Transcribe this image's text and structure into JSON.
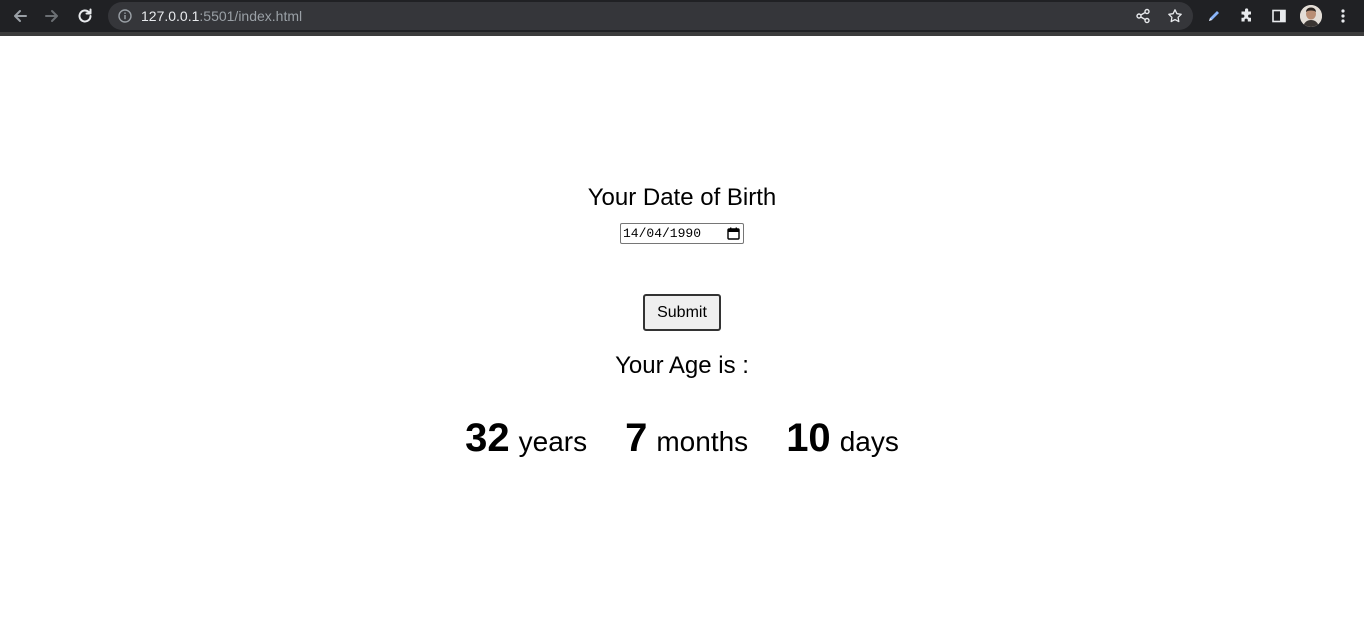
{
  "browser": {
    "url_host": "127.0.0.1",
    "url_path": ":5501/index.html"
  },
  "form": {
    "dob_label": "Your Date of Birth",
    "dob_value": "14/04/1990",
    "submit_label": "Submit"
  },
  "result": {
    "label": "Your Age is :",
    "years": "32",
    "years_unit": "years",
    "months": "7",
    "months_unit": "months",
    "days": "10",
    "days_unit": "days"
  },
  "colors": {
    "chrome_bg": "#202124",
    "omnibox_bg": "#35363a",
    "page_bg": "#ffffff"
  }
}
